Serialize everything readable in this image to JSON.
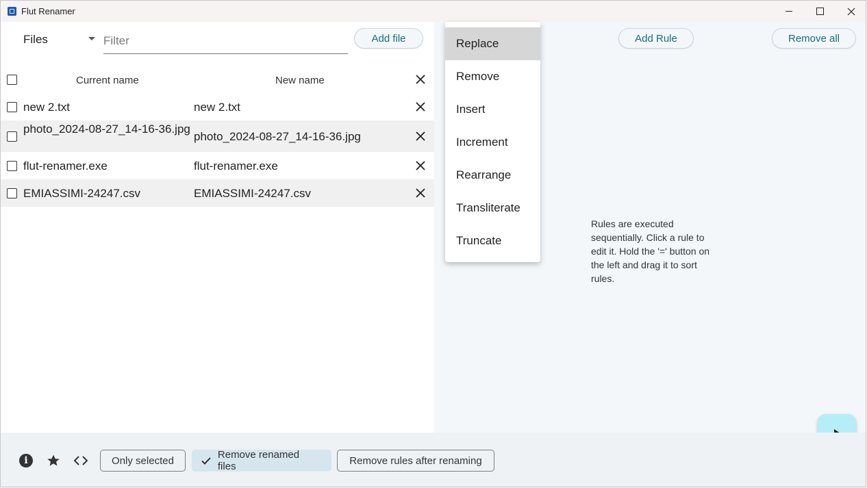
{
  "window": {
    "title": "Flut Renamer"
  },
  "files_panel": {
    "label": "Files",
    "filter_placeholder": "Filter",
    "add_file_label": "Add file",
    "columns": {
      "current": "Current name",
      "new": "New name"
    },
    "rows": [
      {
        "current": "new 2.txt",
        "new": "new 2.txt"
      },
      {
        "current": "photo_2024-08-27_14-16-36.jpg",
        "new": "photo_2024-08-27_14-16-36.jpg"
      },
      {
        "current": "flut-renamer.exe",
        "new": "flut-renamer.exe"
      },
      {
        "current": "EMIASSIMI-24247.csv",
        "new": "EMIASSIMI-24247.csv"
      }
    ]
  },
  "rules_panel": {
    "add_rule_label": "Add Rule",
    "remove_all_label": "Remove all",
    "hint": "Rules are executed sequentially. Click a rule to edit it. Hold the '=' button on the left and drag it to sort rules.",
    "menu_items": [
      "Replace",
      "Remove",
      "Insert",
      "Increment",
      "Rearrange",
      "Transliterate",
      "Truncate"
    ],
    "menu_selected": "Replace"
  },
  "bottom_bar": {
    "only_selected": "Only selected",
    "remove_renamed_files": "Remove renamed files",
    "remove_rules_after_renaming": "Remove rules after renaming",
    "info_icon": "i"
  },
  "colors": {
    "accent_text": "#1a6a80",
    "run_button": "#b5eef8",
    "chip_selected": "#d6e6ef"
  }
}
